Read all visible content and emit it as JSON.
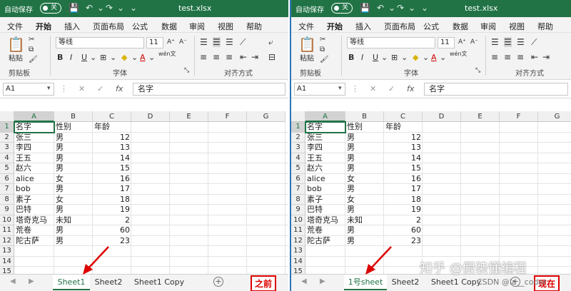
{
  "window": {
    "autosave_label": "自动保存",
    "autosave_state": "关",
    "file_name": "test.xlsx"
  },
  "menu": [
    "文件",
    "开始",
    "插入",
    "页面布局",
    "公式",
    "数据",
    "审阅",
    "视图",
    "帮助"
  ],
  "ribbon": {
    "paste_label": "粘贴",
    "clipboard_group": "剪贴板",
    "font_name": "等线",
    "font_size": "11",
    "font_group": "字体",
    "align_group": "对齐方式",
    "wen_label": "wén文"
  },
  "formula_bar": {
    "name_box": "A1",
    "fx": "fx",
    "value": "名字"
  },
  "columns": [
    "A",
    "B",
    "C",
    "D",
    "E",
    "F",
    "G"
  ],
  "rows": [
    [
      "名字",
      "性别",
      "年龄"
    ],
    [
      "张三",
      "男",
      "12"
    ],
    [
      "李四",
      "男",
      "13"
    ],
    [
      "王五",
      "男",
      "14"
    ],
    [
      "赵六",
      "男",
      "15"
    ],
    [
      "alice",
      "女",
      "16"
    ],
    [
      "bob",
      "男",
      "17"
    ],
    [
      "素子",
      "女",
      "18"
    ],
    [
      "巴特",
      "男",
      "19"
    ],
    [
      "塔奇克马",
      "未知",
      "2"
    ],
    [
      "荒卷",
      "男",
      "60"
    ],
    [
      "陀古萨",
      "男",
      "23"
    ]
  ],
  "row_numbers": [
    "1",
    "2",
    "3",
    "4",
    "5",
    "6",
    "7",
    "8",
    "9",
    "10",
    "11",
    "12",
    "13",
    "14",
    "15"
  ],
  "left_tabs": [
    "Sheet1",
    "Sheet2",
    "Sheet1 Copy"
  ],
  "right_tabs": [
    "1号sheet",
    "Sheet2",
    "Sheet1 Copy"
  ],
  "annotations": {
    "before": "之前",
    "after": "现在"
  },
  "watermark": "知乎 @假装懂编程",
  "csdn": "CSDN @la__coder",
  "colors": {
    "excel_green": "#217346",
    "annotation_red": "#dd0000"
  }
}
